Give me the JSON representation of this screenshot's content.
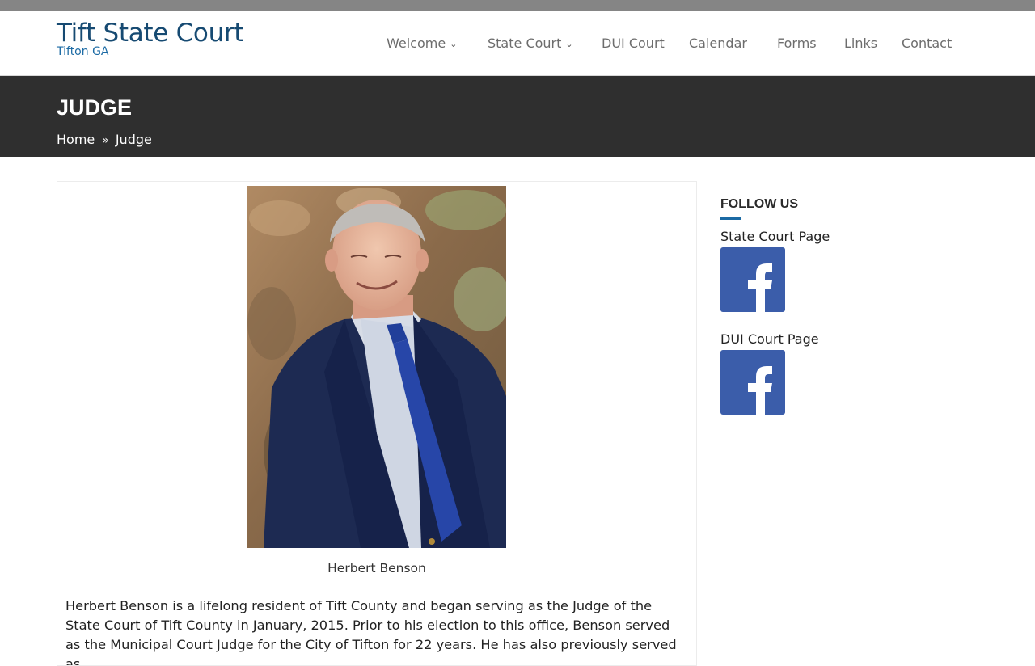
{
  "site": {
    "title": "Tift State Court",
    "tagline": "Tifton GA"
  },
  "nav": {
    "items": [
      {
        "label": "Welcome",
        "has_dropdown": true
      },
      {
        "label": "State Court",
        "has_dropdown": true
      },
      {
        "label": "DUI Court",
        "has_dropdown": false
      },
      {
        "label": "Calendar",
        "has_dropdown": false
      },
      {
        "label": "Forms",
        "has_dropdown": false
      },
      {
        "label": "Links",
        "has_dropdown": false
      },
      {
        "label": "Contact",
        "has_dropdown": false
      }
    ]
  },
  "banner": {
    "title": "JUDGE",
    "breadcrumb": {
      "home": "Home",
      "current": "Judge"
    }
  },
  "main": {
    "photo_icon": "portrait-photo",
    "caption": "Herbert Benson",
    "bio": "Herbert Benson is a lifelong resident of Tift County and began serving as the Judge of the State Court of Tift County in January, 2015. Prior to his election to this office, Benson served as the Municipal Court Judge for the City of Tifton for 22 years. He has also previously served as"
  },
  "sidebar": {
    "widget_title": "FOLLOW US",
    "links": [
      {
        "label": "State Court Page",
        "icon": "facebook-icon"
      },
      {
        "label": "DUI Court Page",
        "icon": "facebook-icon"
      }
    ]
  },
  "colors": {
    "brand": "#164a72",
    "accent": "#1b6aa4",
    "banner": "#2f2f2f",
    "facebook": "#3b5daa"
  }
}
